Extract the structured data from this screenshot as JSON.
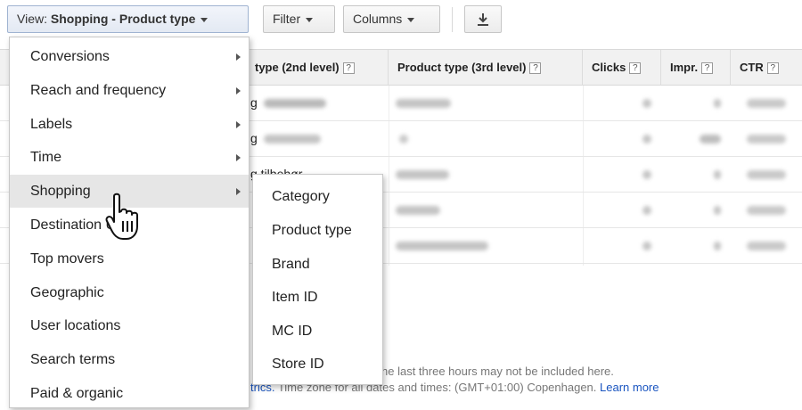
{
  "toolbar": {
    "view_prefix": "View: ",
    "view_value": "Shopping - Product type",
    "filter_label": "Filter",
    "columns_label": "Columns",
    "download_icon": "download-icon"
  },
  "table": {
    "headers": [
      {
        "label": "type (2nd level)",
        "help": "?"
      },
      {
        "label": "Product type (3rd level)",
        "help": "?"
      },
      {
        "label": "Clicks",
        "help": "?"
      },
      {
        "label": "Impr.",
        "help": "?"
      },
      {
        "label": "CTR",
        "help": "?"
      }
    ],
    "row_fragments": [
      "g",
      "g",
      "g tilbehør"
    ]
  },
  "menu": {
    "items": [
      {
        "label": "Conversions",
        "has_submenu": true
      },
      {
        "label": "Reach and frequency",
        "has_submenu": true
      },
      {
        "label": "Labels",
        "has_submenu": true
      },
      {
        "label": "Time",
        "has_submenu": true
      },
      {
        "label": "Shopping",
        "has_submenu": true,
        "highlighted": true
      },
      {
        "label": "Destination URL",
        "has_submenu": false
      },
      {
        "label": "Top movers",
        "has_submenu": false
      },
      {
        "label": "Geographic",
        "has_submenu": false
      },
      {
        "label": "User locations",
        "has_submenu": false
      },
      {
        "label": "Search terms",
        "has_submenu": false
      },
      {
        "label": "Paid & organic",
        "has_submenu": false
      }
    ]
  },
  "submenu": {
    "items": [
      "Category",
      "Product type",
      "Brand",
      "Item ID",
      "MC ID",
      "Store ID"
    ]
  },
  "footer": {
    "line1": "he last three hours may not be included here.",
    "line2_link": "trics.",
    "line2_text": " Time zone for all dates and times: (GMT+01:00) Copenhagen. ",
    "learn_more": "Learn more"
  },
  "colors": {
    "link": "#1a55c0",
    "menu_highlight": "#e6e6e6",
    "header_bg": "#f1f1f1"
  }
}
